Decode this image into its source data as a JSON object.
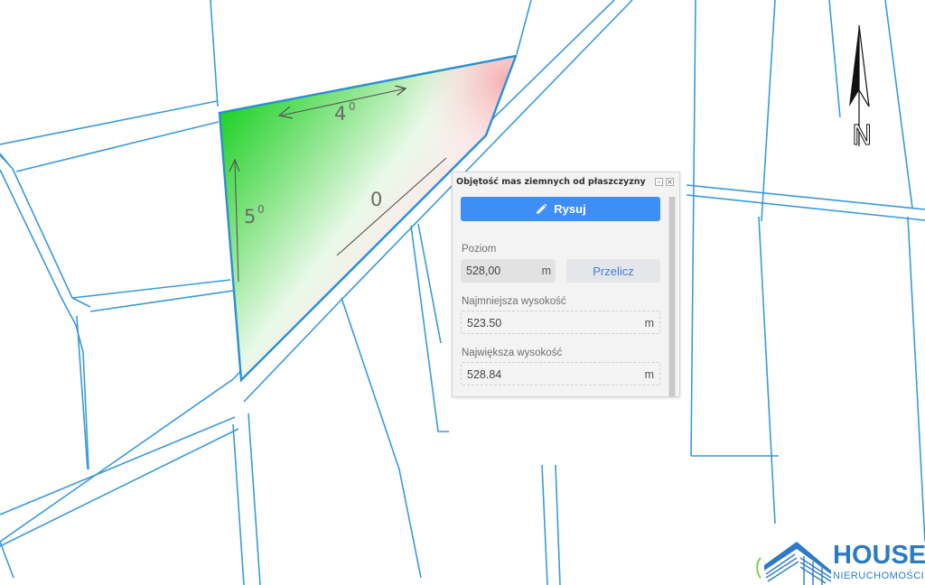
{
  "map": {
    "compass": {
      "north_label": "N"
    },
    "slope_labels": [
      {
        "value": "4",
        "sup": "0"
      },
      {
        "value": "5",
        "sup": "0"
      },
      {
        "value": "0",
        "sup": ""
      }
    ],
    "colors": {
      "parcel_lines": "#3a9ad9",
      "fill_high": "#22d22a",
      "fill_low": "#f3a9aa"
    }
  },
  "panel": {
    "title": "Objętość mas ziemnych od płaszczyzny",
    "draw_button": "Rysuj",
    "level_label": "Poziom",
    "level_value": "528,00",
    "level_unit": "m",
    "recalc_button": "Przelicz",
    "min_label": "Najmniejsza wysokość",
    "min_value": "523.50",
    "min_unit": "m",
    "max_label": "Największa wysokość",
    "max_value": "528.84",
    "max_unit": "m",
    "accent_color": "#3f8ef5"
  },
  "logo": {
    "brand": "HOUSE",
    "tagline": "NIERUCHOMOŚCI"
  }
}
